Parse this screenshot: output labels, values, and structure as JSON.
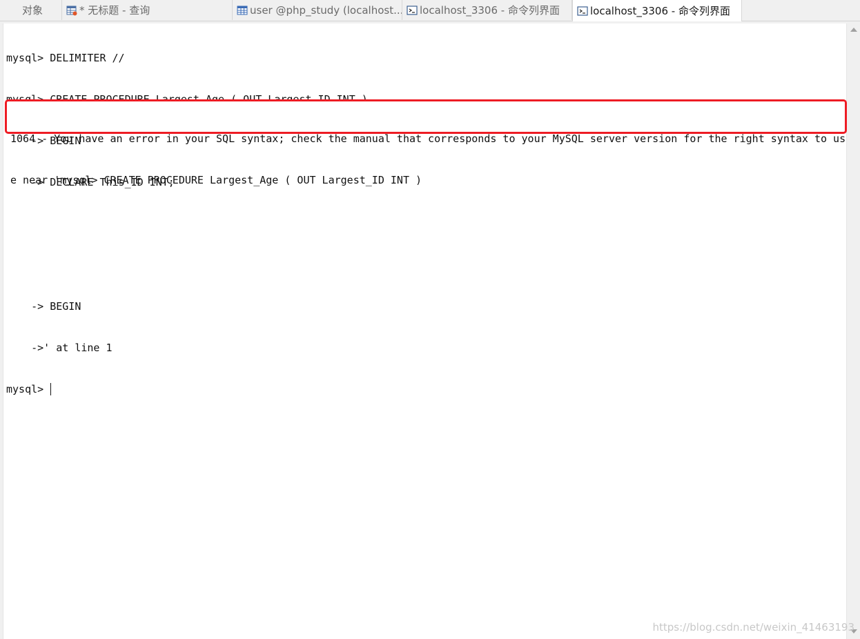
{
  "tabs": [
    {
      "label": "对象",
      "icon": "none"
    },
    {
      "label": "* 无标题 - 查询",
      "icon": "query-table-icon"
    },
    {
      "label": "user @php_study (localhost...",
      "icon": "table-grid-icon"
    },
    {
      "label": "localhost_3306 - 命令列界面",
      "icon": "console-icon"
    },
    {
      "label": "localhost_3306 - 命令列界面",
      "icon": "console-icon",
      "active": true
    }
  ],
  "console": {
    "lines_before_error": [
      "mysql> DELIMITER //",
      "mysql> CREATE PROCEDURE Largest_Age ( OUT Largest_ID INT )",
      "    -> BEGIN",
      "    -> DECLARE This_ID INT;"
    ],
    "error_lines": [
      "1064 - You have an error in your SQL syntax; check the manual that corresponds to your MySQL server version for the right syntax to us",
      "e near 'mysql> CREATE PROCEDURE Largest_Age ( OUT Largest_ID INT )"
    ],
    "lines_after_error": [
      "    -> BEGIN",
      "    ->' at line 1"
    ],
    "prompt": "mysql> "
  },
  "watermark": "https://blog.csdn.net/weixin_41463193",
  "colors": {
    "highlight_border": "#ee1c24",
    "tab_bar_bg": "#f0f0f0",
    "console_bg": "#ffffff",
    "text": "#111111"
  }
}
